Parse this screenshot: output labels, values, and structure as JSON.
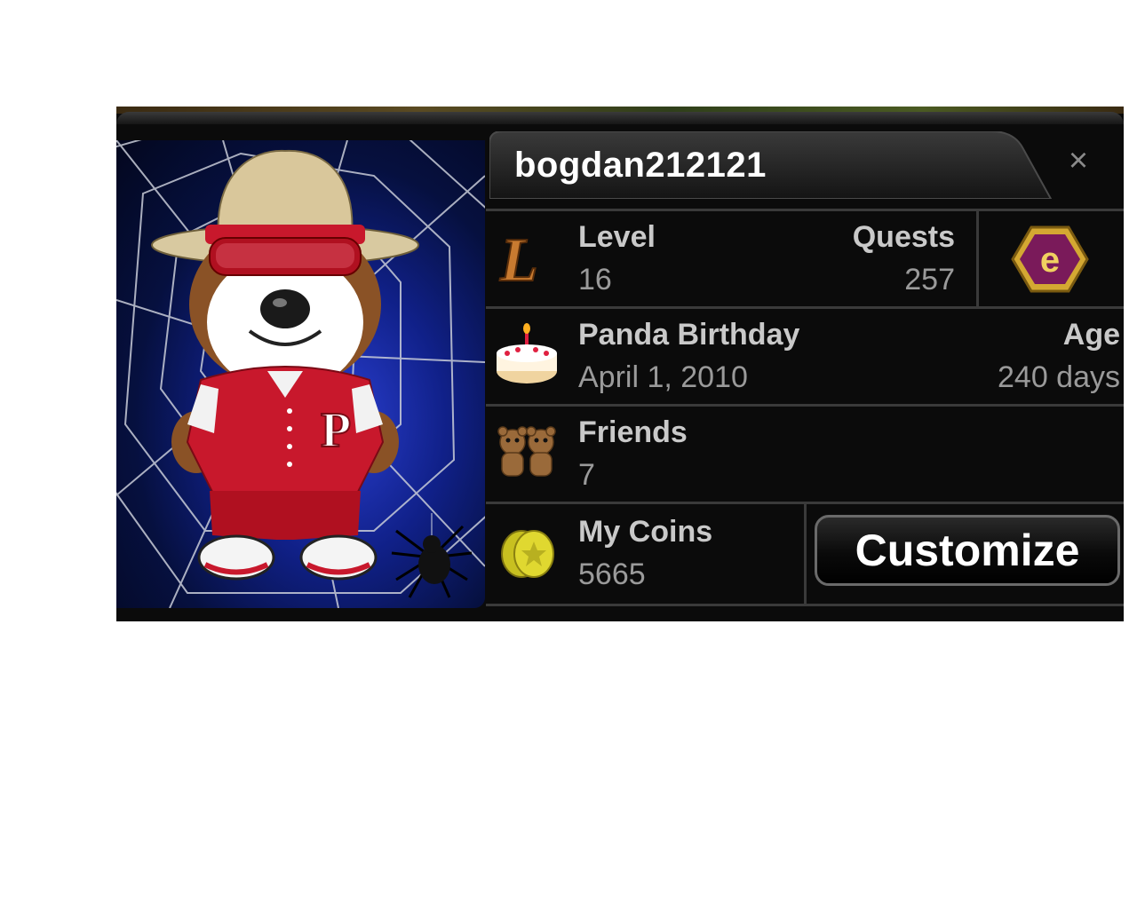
{
  "profile": {
    "username": "bogdan212121",
    "close_label": "×"
  },
  "stats": {
    "level": {
      "label": "Level",
      "value": "16"
    },
    "quests": {
      "label": "Quests",
      "value": "257"
    },
    "birthday": {
      "label": "Panda Birthday",
      "value": "April 1, 2010"
    },
    "age": {
      "label": "Age",
      "value": "240 days"
    },
    "friends": {
      "label": "Friends",
      "value": "7"
    },
    "coins": {
      "label": "My Coins",
      "value": "5665"
    }
  },
  "actions": {
    "customize_label": "Customize"
  },
  "icons": {
    "level": "level-letter-l-icon",
    "badge": "hexagon-e-badge-icon",
    "birthday": "birthday-cake-icon",
    "friends": "two-bears-icon",
    "coins": "gold-coins-icon"
  },
  "colors": {
    "panel_bg": "#0b0b0b",
    "label_text": "#c9c9c9",
    "value_text": "#9a9a9a",
    "portrait_blue": "#1b2fb8"
  }
}
